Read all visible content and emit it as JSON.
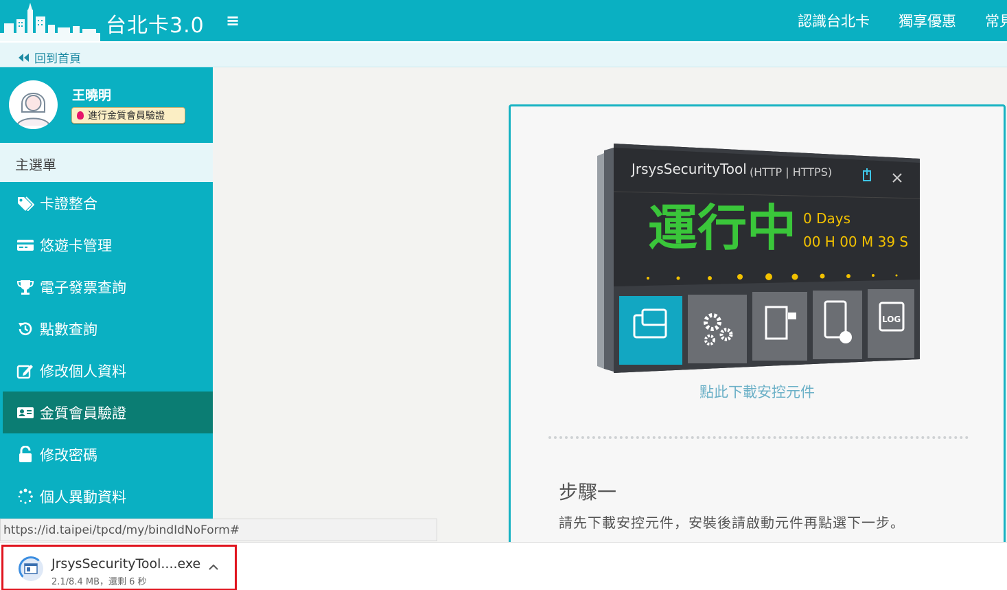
{
  "header": {
    "brand": "台北卡3.0",
    "menu_toggle": "≡",
    "nav": [
      "認識台北卡",
      "獨享優惠",
      "常見"
    ]
  },
  "backbar": {
    "label": "回到首頁"
  },
  "profile": {
    "name": "王曉明",
    "verify_label": "進行金質會員驗證"
  },
  "sidebar": {
    "menu_header": "主選單",
    "items": [
      {
        "label": "卡證整合",
        "icon": "tags-icon"
      },
      {
        "label": "悠遊卡管理",
        "icon": "credit-card-icon"
      },
      {
        "label": "電子發票查詢",
        "icon": "trophy-icon"
      },
      {
        "label": "點數查詢",
        "icon": "history-icon"
      },
      {
        "label": "修改個人資料",
        "icon": "edit-icon"
      },
      {
        "label": "金質會員驗證",
        "icon": "id-card-icon",
        "active": true
      },
      {
        "label": "修改密碼",
        "icon": "unlock-icon"
      },
      {
        "label": "個人異動資料",
        "icon": "spinner-icon"
      }
    ]
  },
  "tool": {
    "title": "JrsysSecurityTool",
    "protocols": "(HTTP | HTTPS)",
    "status": "運行中",
    "days": "0 Days",
    "uptime": "00 H 00 M 39 S"
  },
  "card": {
    "download_link": "點此下載安控元件",
    "step_title": "步驟一",
    "step_desc": "請先下載安控元件，安裝後請啟動元件再點選下一步。"
  },
  "status_url": "https://id.taipei/tpcd/my/bindIdNoForm#",
  "download": {
    "filename": "JrsysSecurityTool....exe",
    "progress": "2.1/8.4 MB，還剩 6 秒"
  },
  "colors": {
    "primary": "#0ab0c2",
    "active_menu": "#0b7d73",
    "highlight_border": "#e0141e",
    "status_green": "#3ac63a"
  }
}
